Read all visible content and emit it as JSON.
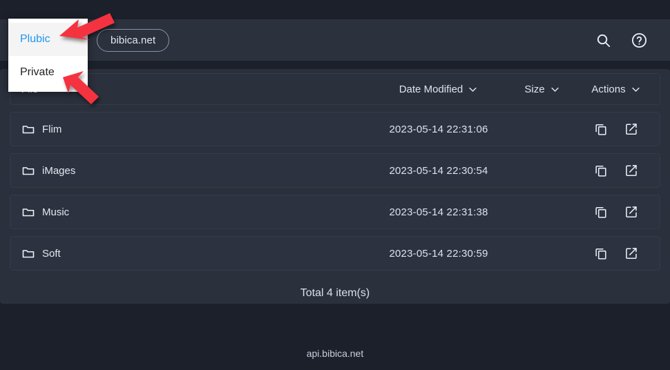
{
  "appbar": {
    "scope_label": "",
    "site_chip": "bibica.net",
    "search_icon": "search-icon",
    "help_icon": "help-circle-icon"
  },
  "dropdown": {
    "items": [
      {
        "label": "Plubic",
        "selected": true
      },
      {
        "label": "Private",
        "selected": false
      }
    ]
  },
  "table": {
    "headers": {
      "file": "File",
      "date_modified": "Date Modified",
      "size": "Size",
      "actions": "Actions"
    },
    "rows": [
      {
        "name": "Flim",
        "date": "2023-05-14 22:31:06",
        "size": "",
        "icon": "folder-icon"
      },
      {
        "name": "iMages",
        "date": "2023-05-14 22:30:54",
        "size": "",
        "icon": "folder-icon"
      },
      {
        "name": "Music",
        "date": "2023-05-14 22:31:38",
        "size": "",
        "icon": "folder-icon"
      },
      {
        "name": "Soft",
        "date": "2023-05-14 22:30:59",
        "size": "",
        "icon": "folder-icon"
      }
    ],
    "total_text": "Total 4 item(s)"
  },
  "footer": {
    "text": "api.bibica.net"
  },
  "colors": {
    "page_background": "#1b202b",
    "panel_background": "#2a303c",
    "appbar_background": "#2b313d",
    "accent_blue": "#2196f3",
    "annotation_red": "#f5333f",
    "text_primary": "#e4e9f1"
  },
  "annotations": {
    "arrow_1": "arrow-pointing-to-plubic",
    "arrow_2": "arrow-pointing-to-private"
  }
}
